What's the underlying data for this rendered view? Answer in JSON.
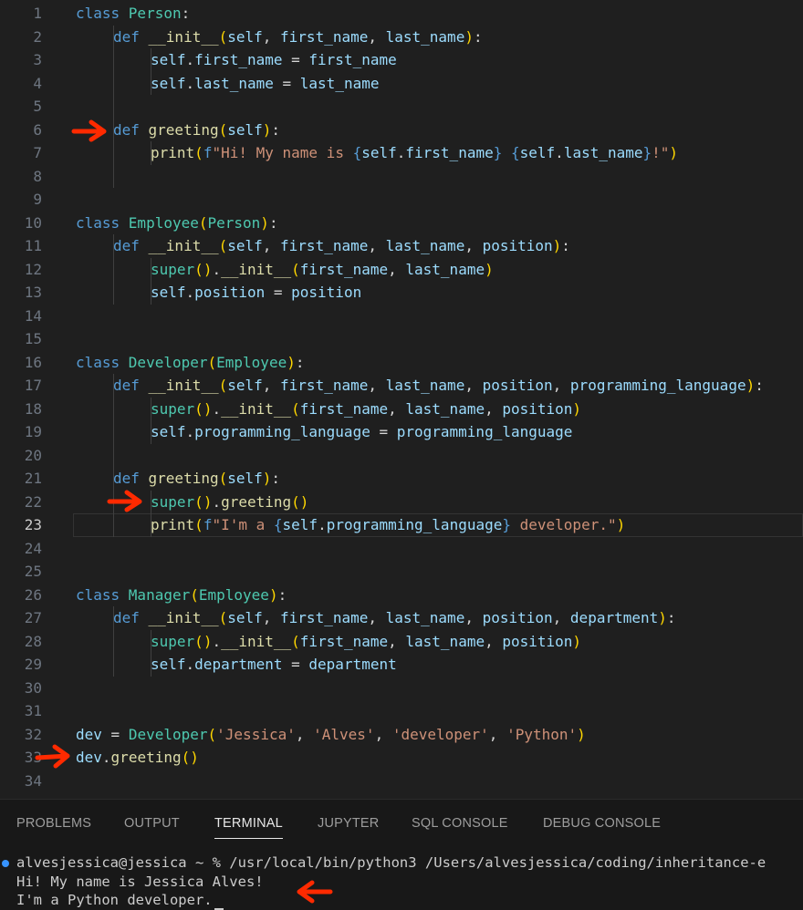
{
  "editor": {
    "active_line": 23,
    "lines": [
      {
        "n": "1",
        "indent": 0,
        "tokens": [
          [
            "kw",
            "class "
          ],
          [
            "cls",
            "Person"
          ],
          [
            "pun",
            ":"
          ]
        ]
      },
      {
        "n": "2",
        "indent": 1,
        "tokens": [
          [
            "kw",
            "def "
          ],
          [
            "fn",
            "__init__"
          ],
          [
            "br1",
            "("
          ],
          [
            "var",
            "self"
          ],
          [
            "pun",
            ", "
          ],
          [
            "var",
            "first_name"
          ],
          [
            "pun",
            ", "
          ],
          [
            "var",
            "last_name"
          ],
          [
            "br1",
            ")"
          ],
          [
            "pun",
            ":"
          ]
        ]
      },
      {
        "n": "3",
        "indent": 2,
        "tokens": [
          [
            "var",
            "self"
          ],
          [
            "pun",
            "."
          ],
          [
            "var",
            "first_name"
          ],
          [
            "pun",
            " = "
          ],
          [
            "var",
            "first_name"
          ]
        ]
      },
      {
        "n": "4",
        "indent": 2,
        "tokens": [
          [
            "var",
            "self"
          ],
          [
            "pun",
            "."
          ],
          [
            "var",
            "last_name"
          ],
          [
            "pun",
            " = "
          ],
          [
            "var",
            "last_name"
          ]
        ]
      },
      {
        "n": "5",
        "indent": 1,
        "tokens": []
      },
      {
        "n": "6",
        "indent": 1,
        "tokens": [
          [
            "kw",
            "def "
          ],
          [
            "fn",
            "greeting"
          ],
          [
            "br1",
            "("
          ],
          [
            "var",
            "self"
          ],
          [
            "br1",
            ")"
          ],
          [
            "pun",
            ":"
          ]
        ]
      },
      {
        "n": "7",
        "indent": 2,
        "tokens": [
          [
            "fn",
            "print"
          ],
          [
            "br1",
            "("
          ],
          [
            "kw",
            "f"
          ],
          [
            "str",
            "\"Hi! My name is "
          ],
          [
            "kw",
            "{"
          ],
          [
            "var",
            "self"
          ],
          [
            "pun",
            "."
          ],
          [
            "var",
            "first_name"
          ],
          [
            "kw",
            "}"
          ],
          [
            "str",
            " "
          ],
          [
            "kw",
            "{"
          ],
          [
            "var",
            "self"
          ],
          [
            "pun",
            "."
          ],
          [
            "var",
            "last_name"
          ],
          [
            "kw",
            "}"
          ],
          [
            "str",
            "!\""
          ],
          [
            "br1",
            ")"
          ]
        ]
      },
      {
        "n": "8",
        "indent": 1,
        "tokens": []
      },
      {
        "n": "9",
        "indent": 0,
        "tokens": []
      },
      {
        "n": "10",
        "indent": 0,
        "tokens": [
          [
            "kw",
            "class "
          ],
          [
            "cls",
            "Employee"
          ],
          [
            "br1",
            "("
          ],
          [
            "cls",
            "Person"
          ],
          [
            "br1",
            ")"
          ],
          [
            "pun",
            ":"
          ]
        ]
      },
      {
        "n": "11",
        "indent": 1,
        "tokens": [
          [
            "kw",
            "def "
          ],
          [
            "fn",
            "__init__"
          ],
          [
            "br1",
            "("
          ],
          [
            "var",
            "self"
          ],
          [
            "pun",
            ", "
          ],
          [
            "var",
            "first_name"
          ],
          [
            "pun",
            ", "
          ],
          [
            "var",
            "last_name"
          ],
          [
            "pun",
            ", "
          ],
          [
            "var",
            "position"
          ],
          [
            "br1",
            ")"
          ],
          [
            "pun",
            ":"
          ]
        ]
      },
      {
        "n": "12",
        "indent": 2,
        "tokens": [
          [
            "cls",
            "super"
          ],
          [
            "br1",
            "("
          ],
          [
            "br1",
            ")"
          ],
          [
            "pun",
            "."
          ],
          [
            "fn",
            "__init__"
          ],
          [
            "br1",
            "("
          ],
          [
            "var",
            "first_name"
          ],
          [
            "pun",
            ", "
          ],
          [
            "var",
            "last_name"
          ],
          [
            "br1",
            ")"
          ]
        ]
      },
      {
        "n": "13",
        "indent": 2,
        "tokens": [
          [
            "var",
            "self"
          ],
          [
            "pun",
            "."
          ],
          [
            "var",
            "position"
          ],
          [
            "pun",
            " = "
          ],
          [
            "var",
            "position"
          ]
        ]
      },
      {
        "n": "14",
        "indent": 0,
        "tokens": []
      },
      {
        "n": "15",
        "indent": 0,
        "tokens": []
      },
      {
        "n": "16",
        "indent": 0,
        "tokens": [
          [
            "kw",
            "class "
          ],
          [
            "cls",
            "Developer"
          ],
          [
            "br1",
            "("
          ],
          [
            "cls",
            "Employee"
          ],
          [
            "br1",
            ")"
          ],
          [
            "pun",
            ":"
          ]
        ]
      },
      {
        "n": "17",
        "indent": 1,
        "tokens": [
          [
            "kw",
            "def "
          ],
          [
            "fn",
            "__init__"
          ],
          [
            "br1",
            "("
          ],
          [
            "var",
            "self"
          ],
          [
            "pun",
            ", "
          ],
          [
            "var",
            "first_name"
          ],
          [
            "pun",
            ", "
          ],
          [
            "var",
            "last_name"
          ],
          [
            "pun",
            ", "
          ],
          [
            "var",
            "position"
          ],
          [
            "pun",
            ", "
          ],
          [
            "var",
            "programming_language"
          ],
          [
            "br1",
            ")"
          ],
          [
            "pun",
            ":"
          ]
        ]
      },
      {
        "n": "18",
        "indent": 2,
        "tokens": [
          [
            "cls",
            "super"
          ],
          [
            "br1",
            "("
          ],
          [
            "br1",
            ")"
          ],
          [
            "pun",
            "."
          ],
          [
            "fn",
            "__init__"
          ],
          [
            "br1",
            "("
          ],
          [
            "var",
            "first_name"
          ],
          [
            "pun",
            ", "
          ],
          [
            "var",
            "last_name"
          ],
          [
            "pun",
            ", "
          ],
          [
            "var",
            "position"
          ],
          [
            "br1",
            ")"
          ]
        ]
      },
      {
        "n": "19",
        "indent": 2,
        "tokens": [
          [
            "var",
            "self"
          ],
          [
            "pun",
            "."
          ],
          [
            "var",
            "programming_language"
          ],
          [
            "pun",
            " = "
          ],
          [
            "var",
            "programming_language"
          ]
        ]
      },
      {
        "n": "20",
        "indent": 1,
        "tokens": []
      },
      {
        "n": "21",
        "indent": 1,
        "tokens": [
          [
            "kw",
            "def "
          ],
          [
            "fn",
            "greeting"
          ],
          [
            "br1",
            "("
          ],
          [
            "var",
            "self"
          ],
          [
            "br1",
            ")"
          ],
          [
            "pun",
            ":"
          ]
        ]
      },
      {
        "n": "22",
        "indent": 2,
        "tokens": [
          [
            "cls",
            "super"
          ],
          [
            "br1",
            "("
          ],
          [
            "br1",
            ")"
          ],
          [
            "pun",
            "."
          ],
          [
            "fn",
            "greeting"
          ],
          [
            "br1",
            "("
          ],
          [
            "br1",
            ")"
          ]
        ]
      },
      {
        "n": "23",
        "indent": 2,
        "tokens": [
          [
            "fn",
            "print"
          ],
          [
            "br1",
            "("
          ],
          [
            "kw",
            "f"
          ],
          [
            "str",
            "\"I'm a "
          ],
          [
            "kw",
            "{"
          ],
          [
            "var",
            "self"
          ],
          [
            "pun",
            "."
          ],
          [
            "var",
            "programming_language"
          ],
          [
            "kw",
            "}"
          ],
          [
            "str",
            " developer.\""
          ],
          [
            "br1",
            ")"
          ]
        ]
      },
      {
        "n": "24",
        "indent": 0,
        "tokens": []
      },
      {
        "n": "25",
        "indent": 0,
        "tokens": []
      },
      {
        "n": "26",
        "indent": 0,
        "tokens": [
          [
            "kw",
            "class "
          ],
          [
            "cls",
            "Manager"
          ],
          [
            "br1",
            "("
          ],
          [
            "cls",
            "Employee"
          ],
          [
            "br1",
            ")"
          ],
          [
            "pun",
            ":"
          ]
        ]
      },
      {
        "n": "27",
        "indent": 1,
        "tokens": [
          [
            "kw",
            "def "
          ],
          [
            "fn",
            "__init__"
          ],
          [
            "br1",
            "("
          ],
          [
            "var",
            "self"
          ],
          [
            "pun",
            ", "
          ],
          [
            "var",
            "first_name"
          ],
          [
            "pun",
            ", "
          ],
          [
            "var",
            "last_name"
          ],
          [
            "pun",
            ", "
          ],
          [
            "var",
            "position"
          ],
          [
            "pun",
            ", "
          ],
          [
            "var",
            "department"
          ],
          [
            "br1",
            ")"
          ],
          [
            "pun",
            ":"
          ]
        ]
      },
      {
        "n": "28",
        "indent": 2,
        "tokens": [
          [
            "cls",
            "super"
          ],
          [
            "br1",
            "("
          ],
          [
            "br1",
            ")"
          ],
          [
            "pun",
            "."
          ],
          [
            "fn",
            "__init__"
          ],
          [
            "br1",
            "("
          ],
          [
            "var",
            "first_name"
          ],
          [
            "pun",
            ", "
          ],
          [
            "var",
            "last_name"
          ],
          [
            "pun",
            ", "
          ],
          [
            "var",
            "position"
          ],
          [
            "br1",
            ")"
          ]
        ]
      },
      {
        "n": "29",
        "indent": 2,
        "tokens": [
          [
            "var",
            "self"
          ],
          [
            "pun",
            "."
          ],
          [
            "var",
            "department"
          ],
          [
            "pun",
            " = "
          ],
          [
            "var",
            "department"
          ]
        ]
      },
      {
        "n": "30",
        "indent": 0,
        "tokens": []
      },
      {
        "n": "31",
        "indent": 0,
        "tokens": []
      },
      {
        "n": "32",
        "indent": 0,
        "tokens": [
          [
            "var",
            "dev"
          ],
          [
            "pun",
            " = "
          ],
          [
            "cls",
            "Developer"
          ],
          [
            "br1",
            "("
          ],
          [
            "str",
            "'Jessica'"
          ],
          [
            "pun",
            ", "
          ],
          [
            "str",
            "'Alves'"
          ],
          [
            "pun",
            ", "
          ],
          [
            "str",
            "'developer'"
          ],
          [
            "pun",
            ", "
          ],
          [
            "str",
            "'Python'"
          ],
          [
            "br1",
            ")"
          ]
        ]
      },
      {
        "n": "33",
        "indent": 0,
        "tokens": [
          [
            "var",
            "dev"
          ],
          [
            "pun",
            "."
          ],
          [
            "fn",
            "greeting"
          ],
          [
            "br1",
            "("
          ],
          [
            "br1",
            ")"
          ]
        ]
      },
      {
        "n": "34",
        "indent": 0,
        "tokens": []
      }
    ]
  },
  "panel": {
    "tabs": [
      {
        "label": "PROBLEMS"
      },
      {
        "label": "OUTPUT"
      },
      {
        "label": "TERMINAL",
        "active": true
      },
      {
        "label": "JUPYTER"
      },
      {
        "label": "SQL CONSOLE"
      },
      {
        "label": "DEBUG CONSOLE"
      }
    ],
    "terminal": {
      "prompt_line": "alvesjessica@jessica ~ % /usr/local/bin/python3 /Users/alvesjessica/coding/inheritance-e",
      "output_1": "Hi! My name is Jessica Alves!",
      "output_2": "I'm a Python developer."
    }
  },
  "colors": {
    "arrow": "#ff2a00",
    "accent_dot": "#3794ff"
  }
}
